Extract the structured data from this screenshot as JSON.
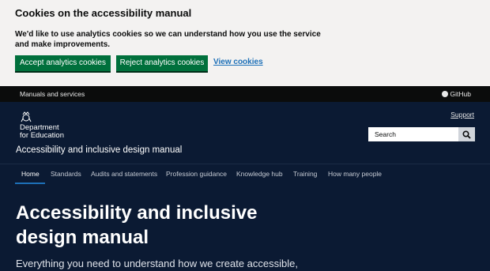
{
  "cookie_banner": {
    "title": "Cookies on the accessibility manual",
    "text": "We'd like to use analytics cookies so we can understand how you use the service and make improvements.",
    "accept_label": "Accept analytics cookies",
    "reject_label": "Reject analytics cookies",
    "view_label": "View cookies"
  },
  "top_strip": {
    "left_link": "Manuals and services",
    "github_label": "GitHub"
  },
  "header": {
    "department_line1": "Department",
    "department_line2": "for Education",
    "manual_title": "Accessibility and inclusive design manual",
    "support_label": "Support",
    "search_placeholder": "Search"
  },
  "nav": {
    "items": [
      {
        "label": "Home"
      },
      {
        "label": "Standards"
      },
      {
        "label": "Audits and statements"
      },
      {
        "label": "Profession guidance"
      },
      {
        "label": "Knowledge hub"
      },
      {
        "label": "Training"
      },
      {
        "label": "How many people"
      }
    ]
  },
  "hero": {
    "title": "Accessibility and inclusive design manual",
    "lead": "Everything you need to understand how we create accessible,"
  },
  "colors": {
    "page_bg": "#0b1a33",
    "strip_bg": "#0b0c0c",
    "cookie_bg": "#f3f2f1",
    "button_green": "#00703c",
    "link_blue": "#1d70b8"
  },
  "icons": {
    "github": "github-icon",
    "crest": "royal-crest-icon",
    "search": "magnifier-icon"
  }
}
